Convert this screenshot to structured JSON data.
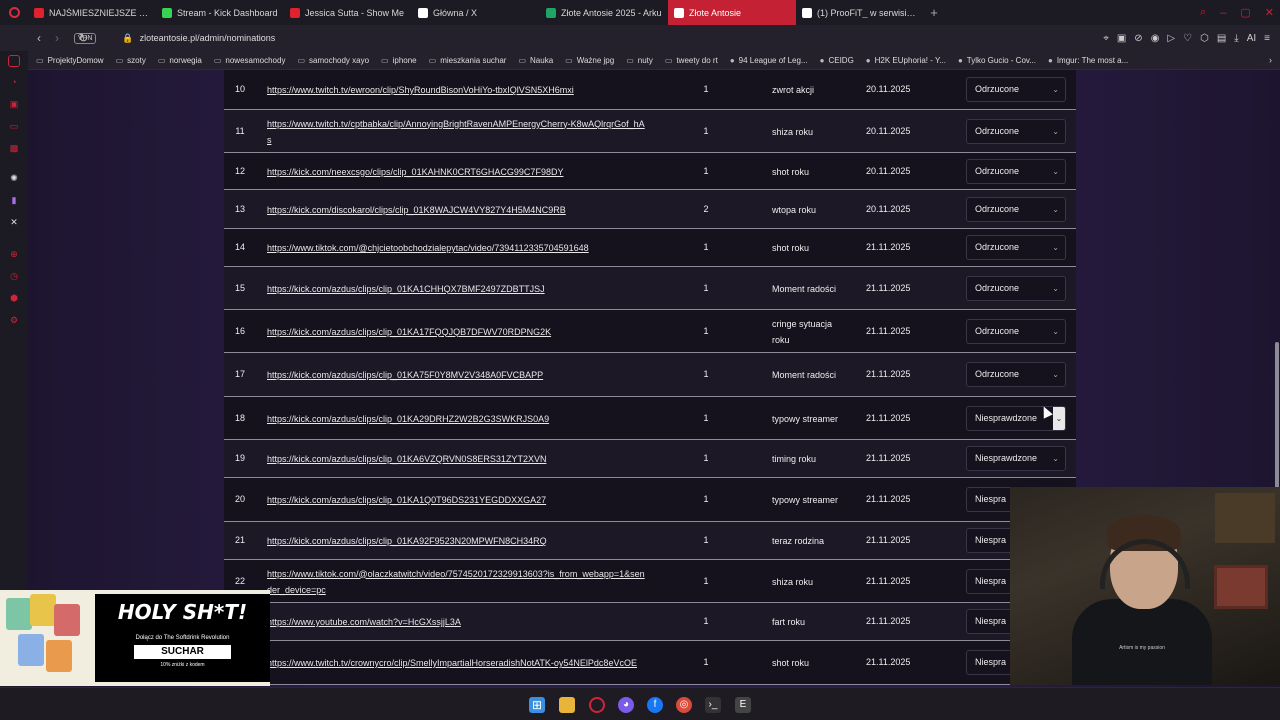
{
  "browser": {
    "tabs": [
      {
        "title": "NAJŚMIESZNIEJSZE MOM",
        "icon": "youtube-icon",
        "color": "#e1222d"
      },
      {
        "title": "Stream - Kick Dashboard",
        "icon": "kick-icon",
        "color": "#39d353"
      },
      {
        "title": "Jessica Sutta - Show Me",
        "icon": "youtube-icon",
        "color": "#e1222d"
      },
      {
        "title": "Główna / X",
        "icon": "x-icon",
        "color": "#ffffff"
      },
      {
        "title": "Złote Antosie 2025 - Arku",
        "icon": "sheets-icon",
        "color": "#1fa463"
      },
      {
        "title": "Złote Antosie",
        "icon": "site-icon",
        "color": "#ffffff",
        "active": true
      },
      {
        "title": "(1) ProoFiT_ w serwisie X",
        "icon": "x-icon",
        "color": "#ffffff"
      }
    ],
    "url": "zloteantosie.pl/admin/nominations",
    "vpn_label": "VPN",
    "bookmarks": [
      {
        "label": "ProjektyDomow",
        "icon": "folder-icon"
      },
      {
        "label": "szoty",
        "icon": "folder-icon"
      },
      {
        "label": "norwegia",
        "icon": "folder-icon"
      },
      {
        "label": "nowesamochody",
        "icon": "folder-icon"
      },
      {
        "label": "samochody xayo",
        "icon": "folder-icon"
      },
      {
        "label": "iphone",
        "icon": "folder-icon"
      },
      {
        "label": "mieszkania suchar",
        "icon": "folder-icon"
      },
      {
        "label": "Nauka",
        "icon": "folder-icon"
      },
      {
        "label": "Ważne jpg",
        "icon": "folder-icon"
      },
      {
        "label": "nuty",
        "icon": "folder-icon"
      },
      {
        "label": "tweety do rt",
        "icon": "folder-icon"
      },
      {
        "label": "94 League of Leg...",
        "icon": "lol-icon"
      },
      {
        "label": "CEIDG",
        "icon": "ceidg-icon"
      },
      {
        "label": "H2K EUphoria! - Y...",
        "icon": "youtube-icon"
      },
      {
        "label": "Tylko Gucio - Cov...",
        "icon": "youtube-icon"
      },
      {
        "label": "Imgur: The most a...",
        "icon": "imgur-icon"
      }
    ]
  },
  "nominations": [
    {
      "id": "10",
      "link": "https://www.twitch.tv/ewroon/clip/ShyRoundBisonVoHiYo-tbxIQlVSN5XH6mxi",
      "count": "1",
      "category": "zwrot akcji",
      "date": "20.11.2025",
      "status": "Odrzucone"
    },
    {
      "id": "11",
      "link": "https://www.twitch.tv/cptbabka/clip/AnnoyingBrightRavenAMPEnergyCherry-K8wAQlrqrGof_hAs",
      "count": "1",
      "category": "shiza roku",
      "date": "20.11.2025",
      "status": "Odrzucone"
    },
    {
      "id": "12",
      "link": "https://kick.com/neexcsgo/clips/clip_01KAHNK0CRT6GHACG99C7F98DY",
      "count": "1",
      "category": "shot roku",
      "date": "20.11.2025",
      "status": "Odrzucone"
    },
    {
      "id": "13",
      "link": "https://kick.com/discokarol/clips/clip_01K8WAJCW4VY827Y4H5M4NC9RB",
      "count": "2",
      "category": "wtopa roku",
      "date": "20.11.2025",
      "status": "Odrzucone"
    },
    {
      "id": "14",
      "link": "https://www.tiktok.com/@chjcietoobchodzialepytac/video/7394112335704591648",
      "count": "1",
      "category": "shot roku",
      "date": "21.11.2025",
      "status": "Odrzucone"
    },
    {
      "id": "15",
      "link": "https://kick.com/azdus/clips/clip_01KA1CHHQX7BMF2497ZDBTTJSJ",
      "count": "1",
      "category": "Moment radości",
      "date": "21.11.2025",
      "status": "Odrzucone"
    },
    {
      "id": "16",
      "link": "https://kick.com/azdus/clips/clip_01KA17FQQJQB7DFWV70RDPNG2K",
      "count": "1",
      "category": "cringe sytuacja roku",
      "date": "21.11.2025",
      "status": "Odrzucone"
    },
    {
      "id": "17",
      "link": "https://kick.com/azdus/clips/clip_01KA75F0Y8MV2V348A0FVCBAPP",
      "count": "1",
      "category": "Moment radości",
      "date": "21.11.2025",
      "status": "Odrzucone"
    },
    {
      "id": "18",
      "link": "https://kick.com/azdus/clips/clip_01KA29DRHZ2W2B2G3SWKRJS0A9",
      "count": "1",
      "category": "typowy streamer",
      "date": "21.11.2025",
      "status": "Niesprawdzone"
    },
    {
      "id": "19",
      "link": "https://kick.com/azdus/clips/clip_01KA6VZQRVN0S8ERS31ZYT2XVN",
      "count": "1",
      "category": "timing roku",
      "date": "21.11.2025",
      "status": "Niesprawdzone"
    },
    {
      "id": "20",
      "link": "https://kick.com/azdus/clips/clip_01KA1Q0T96DS231YEGDDXXGA27",
      "count": "1",
      "category": "typowy streamer",
      "date": "21.11.2025",
      "status": "Niespra"
    },
    {
      "id": "21",
      "link": "https://kick.com/azdus/clips/clip_01KA92F9523N20MPWFN8CH34RQ",
      "count": "1",
      "category": "teraz rodzina",
      "date": "21.11.2025",
      "status": "Niespra"
    },
    {
      "id": "22",
      "link": "https://www.tiktok.com/@olaczkatwitch/video/7574520172329913603?is_from_webapp=1&sender_device=pc",
      "count": "1",
      "category": "shiza roku",
      "date": "21.11.2025",
      "status": "Niespra"
    },
    {
      "id": "23",
      "link": "https://www.youtube.com/watch?v=HcGXssjjL3A",
      "count": "1",
      "category": "fart roku",
      "date": "21.11.2025",
      "status": "Niespra"
    },
    {
      "id": "24",
      "link": "https://www.twitch.tv/crownycro/clip/SmellyImpartialHorseradishNotATK-oy54NElPdc8eVcOE",
      "count": "1",
      "category": "shot roku",
      "date": "21.11.2025",
      "status": "Niespra"
    }
  ],
  "ad": {
    "title": "HOLY SH*T!",
    "subtitle": "Dołącz do The Softdrink Revolution",
    "brand": "SUCHAR",
    "discount": "10% zniżki z kodem"
  },
  "webcam": {
    "shirt_text": "Artism is my passion"
  }
}
